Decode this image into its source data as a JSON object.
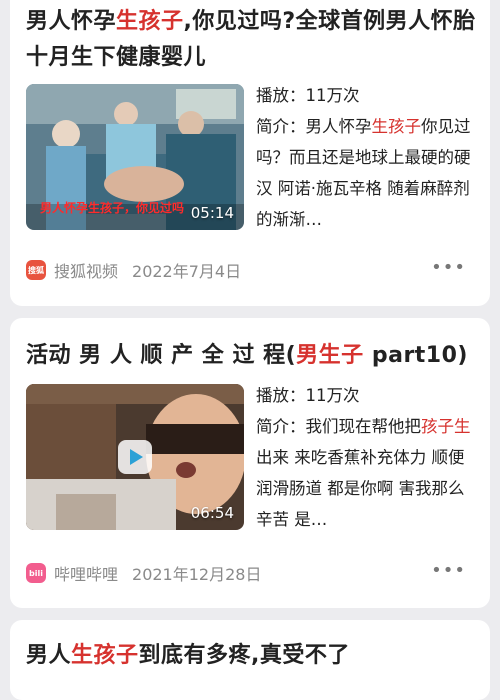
{
  "results": [
    {
      "title_parts": [
        {
          "text": "男人怀孕",
          "hl": false
        },
        {
          "text": "生孩子",
          "hl": true
        },
        {
          "text": ",你见过吗?全球首例男人怀胎十月生下健康婴儿",
          "hl": false
        }
      ],
      "duration": "05:14",
      "video_caption": "男人怀孕生孩子，你见过吗",
      "plays_label": "播放：",
      "plays_value": "11万次",
      "intro_label": "简介：",
      "intro_parts": [
        {
          "text": "男人怀孕",
          "hl": false
        },
        {
          "text": "生孩子",
          "hl": true
        },
        {
          "text": "你见过吗？而且还是地球上最硬的硬汉 阿诺·施瓦辛格 随着麻醉剂的渐渐…",
          "hl": false
        }
      ],
      "source_name": "搜狐视频",
      "source_icon": "sohu-video-icon",
      "source_icon_text": "搜狐",
      "source_color": "#e8533f",
      "date": "2022年7月4日",
      "more_label": "•••"
    },
    {
      "title_parts": [
        {
          "text": "活动 男 人 顺 产 全 过 程(",
          "hl": false
        },
        {
          "text": "男生子",
          "hl": true
        },
        {
          "text": " part10)",
          "hl": false
        }
      ],
      "duration": "06:54",
      "plays_label": "播放：",
      "plays_value": "11万次",
      "intro_label": "简介：",
      "intro_parts": [
        {
          "text": "我们现在帮他把",
          "hl": false
        },
        {
          "text": "孩子生",
          "hl": true
        },
        {
          "text": "出来 来吃香蕉补充体力 顺便润滑肠道 都是你啊 害我那么辛苦 是…",
          "hl": false
        }
      ],
      "source_name": "哔哩哔哩",
      "source_icon": "bilibili-icon",
      "source_icon_text": "bili",
      "source_color": "#f25d8e",
      "date": "2021年12月28日",
      "more_label": "•••"
    },
    {
      "title_parts": [
        {
          "text": "男人",
          "hl": false
        },
        {
          "text": "生孩子",
          "hl": true
        },
        {
          "text": "到底有多疼,真受不了",
          "hl": false
        }
      ]
    }
  ]
}
